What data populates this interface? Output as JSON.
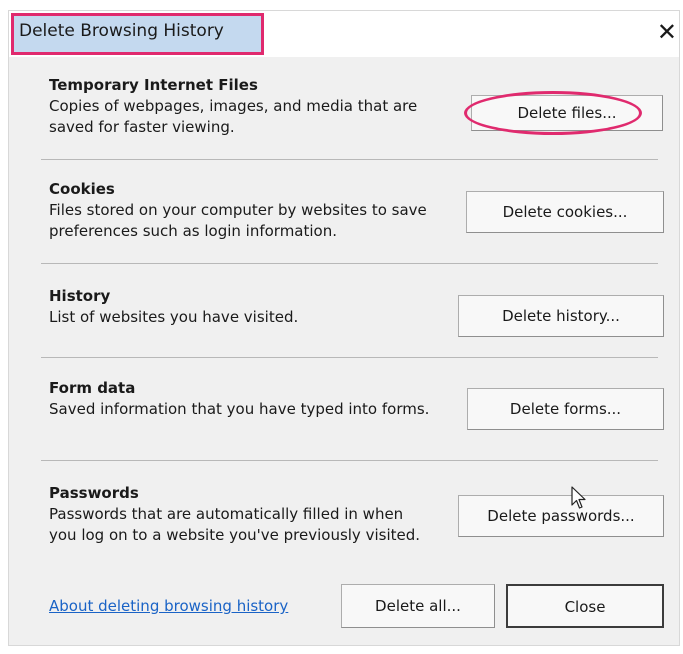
{
  "dialog": {
    "title": "Delete Browsing History",
    "close_glyph": "✕"
  },
  "sections": [
    {
      "title": "Temporary Internet Files",
      "description": "Copies of webpages, images, and media that are saved for faster viewing.",
      "button": "Delete files..."
    },
    {
      "title": "Cookies",
      "description": "Files stored on your computer by websites to save preferences such as login information.",
      "button": "Delete cookies..."
    },
    {
      "title": "History",
      "description": "List of websites you have visited.",
      "button": "Delete history..."
    },
    {
      "title": "Form data",
      "description": "Saved information that you have typed into forms.",
      "button": "Delete forms..."
    },
    {
      "title": "Passwords",
      "description": "Passwords that are automatically filled in when you log on to a website you've previously visited.",
      "button": "Delete passwords..."
    }
  ],
  "footer": {
    "link": "About deleting browsing history",
    "delete_all": "Delete all...",
    "close": "Close"
  },
  "highlight_color": "#e02a6e",
  "icons": [
    "close-icon",
    "mouse-pointer-icon"
  ]
}
